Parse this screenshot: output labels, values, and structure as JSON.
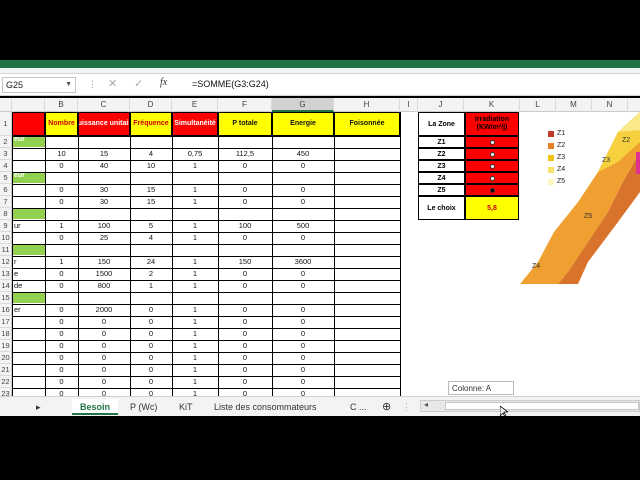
{
  "name_box": "G25",
  "formula_bar": {
    "fx": "fx",
    "formula": "=SOMME(G3:G24)",
    "cancel_icon": "✕",
    "enter_icon": "✓"
  },
  "columns": [
    "B",
    "C",
    "D",
    "E",
    "F",
    "G",
    "H",
    "I",
    "J",
    "K",
    "L",
    "M",
    "N"
  ],
  "row_numbers": [
    "1",
    "2",
    "3",
    "4",
    "5",
    "6",
    "7",
    "8",
    "9",
    "10",
    "11",
    "12",
    "13",
    "14",
    "15",
    "16",
    "17",
    "18",
    "19",
    "20",
    "21",
    "22",
    "23"
  ],
  "headers": {
    "a": "",
    "b": "Nombre",
    "c": "Puissance unitaire",
    "d": "Fréquence",
    "e": "Simultanéité",
    "f": "P totale",
    "g": "Energie",
    "h": "Foisonnée"
  },
  "bands": {
    "r2": "eur",
    "r5": "eur",
    "r8": "",
    "r11": "",
    "r15": ""
  },
  "rows": [
    {
      "row": "3",
      "a": "",
      "b": "10",
      "c": "15",
      "d": "4",
      "e": "0,75",
      "f": "112,5",
      "g": "450"
    },
    {
      "row": "4",
      "a": "",
      "b": "0",
      "c": "40",
      "d": "10",
      "e": "1",
      "f": "0",
      "g": "0"
    },
    {
      "row": "6",
      "a": "",
      "b": "0",
      "c": "30",
      "d": "15",
      "e": "1",
      "f": "0",
      "g": "0"
    },
    {
      "row": "7",
      "a": "",
      "b": "0",
      "c": "30",
      "d": "15",
      "e": "1",
      "f": "0",
      "g": "0"
    },
    {
      "row": "9",
      "a": "ur",
      "b": "1",
      "c": "100",
      "d": "5",
      "e": "1",
      "f": "100",
      "g": "500"
    },
    {
      "row": "10",
      "a": "",
      "b": "0",
      "c": "25",
      "d": "4",
      "e": "1",
      "f": "0",
      "g": "0"
    },
    {
      "row": "12",
      "a": "r",
      "b": "1",
      "c": "150",
      "d": "24",
      "e": "1",
      "f": "150",
      "g": "3600"
    },
    {
      "row": "13",
      "a": "e",
      "b": "0",
      "c": "1500",
      "d": "2",
      "e": "1",
      "f": "0",
      "g": "0"
    },
    {
      "row": "14",
      "a": "de",
      "b": "0",
      "c": "800",
      "d": "1",
      "e": "1",
      "f": "0",
      "g": "0"
    },
    {
      "row": "16",
      "a": "er",
      "b": "0",
      "c": "2000",
      "d": "0",
      "e": "1",
      "f": "0",
      "g": "0"
    },
    {
      "row": "17",
      "a": "",
      "b": "0",
      "c": "0",
      "d": "0",
      "e": "1",
      "f": "0",
      "g": "0"
    },
    {
      "row": "18",
      "a": "",
      "b": "0",
      "c": "0",
      "d": "0",
      "e": "1",
      "f": "0",
      "g": "0"
    },
    {
      "row": "19",
      "a": "",
      "b": "0",
      "c": "0",
      "d": "0",
      "e": "1",
      "f": "0",
      "g": "0"
    },
    {
      "row": "20",
      "a": "",
      "b": "0",
      "c": "0",
      "d": "0",
      "e": "1",
      "f": "0",
      "g": "0"
    },
    {
      "row": "21",
      "a": "",
      "b": "0",
      "c": "0",
      "d": "0",
      "e": "1",
      "f": "0",
      "g": "0"
    },
    {
      "row": "22",
      "a": "",
      "b": "0",
      "c": "0",
      "d": "0",
      "e": "1",
      "f": "0",
      "g": "0"
    },
    {
      "row": "23",
      "a": "",
      "b": "0",
      "c": "0",
      "d": "0",
      "e": "1",
      "f": "0",
      "g": "0"
    }
  ],
  "zone_table": {
    "header_zone": "La Zone",
    "header_irr": "Irradiation (KW/m²/j)",
    "zones": [
      "Z1",
      "Z2",
      "Z3",
      "Z4",
      "Z5"
    ],
    "choice_label": "Le choix",
    "choice_value": "5,8"
  },
  "map_legend": [
    {
      "label": "Z1",
      "color": "#c0392b"
    },
    {
      "label": "Z2",
      "color": "#e67e22"
    },
    {
      "label": "Z3",
      "color": "#f1c40f"
    },
    {
      "label": "Z4",
      "color": "#f7e36a"
    },
    {
      "label": "Z5",
      "color": "#fff7c0"
    }
  ],
  "map_labels": [
    "Z2",
    "Z3",
    "Z5",
    "Z4"
  ],
  "tabs": [
    "Besoin",
    "P (Wc)",
    "KiT",
    "Liste des consommateurs",
    "C ..."
  ],
  "tooltip": "Colonne: A",
  "colors": {
    "excel_green": "#217346",
    "yellow": "#ffff00",
    "red": "#ff0000",
    "band_green": "#92d050"
  }
}
